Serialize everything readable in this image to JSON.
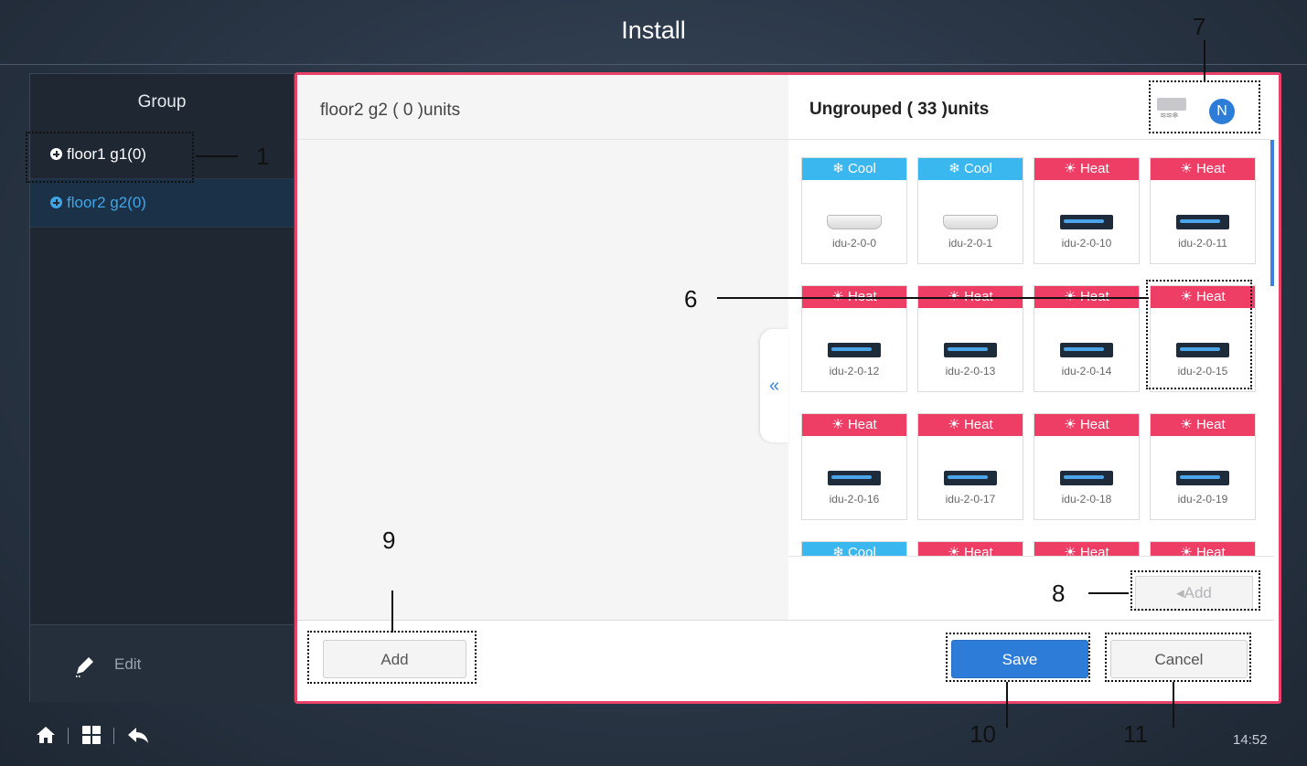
{
  "header": {
    "title": "Install"
  },
  "sidebar": {
    "heading": "Group",
    "groups": [
      {
        "label": "floor1 g1(0)",
        "color": "#ffffff"
      },
      {
        "label": "floor2 g2(0)",
        "color": "#3ea6e8"
      }
    ],
    "edit_label": "Edit"
  },
  "main": {
    "left_title": "floor2 g2 ( 0 )units",
    "right_title": "Ungrouped ( 33 )units",
    "mode_badge": "N",
    "collapse_symbol": "«",
    "units": [
      {
        "mode": "Cool",
        "name": "idu-2-0-0",
        "type": "wall"
      },
      {
        "mode": "Cool",
        "name": "idu-2-0-1",
        "type": "wall"
      },
      {
        "mode": "Heat",
        "name": "idu-2-0-10",
        "type": "duct"
      },
      {
        "mode": "Heat",
        "name": "idu-2-0-11",
        "type": "duct"
      },
      {
        "mode": "Heat",
        "name": "idu-2-0-12",
        "type": "duct"
      },
      {
        "mode": "Heat",
        "name": "idu-2-0-13",
        "type": "duct"
      },
      {
        "mode": "Heat",
        "name": "idu-2-0-14",
        "type": "duct"
      },
      {
        "mode": "Heat",
        "name": "idu-2-0-15",
        "type": "duct"
      },
      {
        "mode": "Heat",
        "name": "idu-2-0-16",
        "type": "duct"
      },
      {
        "mode": "Heat",
        "name": "idu-2-0-17",
        "type": "duct"
      },
      {
        "mode": "Heat",
        "name": "idu-2-0-18",
        "type": "duct"
      },
      {
        "mode": "Heat",
        "name": "idu-2-0-19",
        "type": "duct"
      },
      {
        "mode": "Cool",
        "name": "",
        "type": "wall"
      },
      {
        "mode": "Heat",
        "name": "",
        "type": "duct"
      },
      {
        "mode": "Heat",
        "name": "",
        "type": "duct"
      },
      {
        "mode": "Heat",
        "name": "",
        "type": "duct"
      }
    ],
    "add_right_label": "Add",
    "add_left_label": "Add",
    "save_label": "Save",
    "cancel_label": "Cancel"
  },
  "callouts": {
    "c1": "1",
    "c6": "6",
    "c7": "7",
    "c8": "8",
    "c9": "9",
    "c10": "10",
    "c11": "11"
  },
  "footer": {
    "time": "14:52"
  },
  "colors": {
    "accent_border": "#e8416a",
    "cool": "#3bb7f0",
    "heat": "#ee3e66",
    "save": "#2d7dd8"
  }
}
